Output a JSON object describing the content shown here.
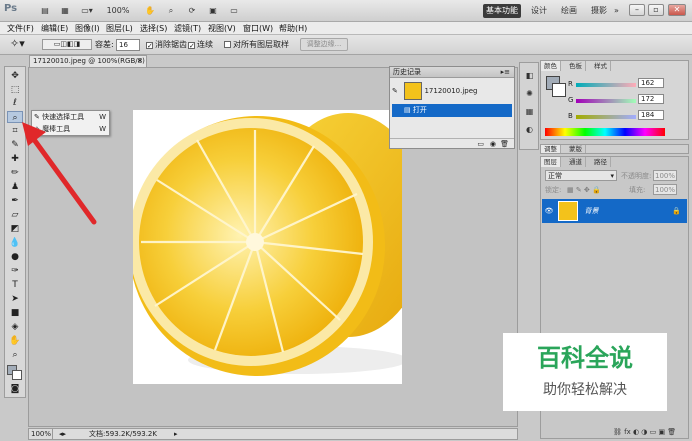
{
  "app": {
    "logo": "Ps",
    "zoom": "100%",
    "workspace_active": "基本功能",
    "workspace_links": [
      "设计",
      "绘画",
      "摄影"
    ],
    "more": "»"
  },
  "menu": [
    "文件(F)",
    "编辑(E)",
    "图像(I)",
    "图层(L)",
    "选择(S)",
    "滤镜(T)",
    "视图(V)",
    "窗口(W)",
    "帮助(H)"
  ],
  "options": {
    "tolerance_label": "容差:",
    "tolerance_value": "16",
    "antialias": "消除锯齿",
    "contiguous": "连续",
    "sample_all": "对所有图层取样",
    "refine": "调整边缘..."
  },
  "document": {
    "tab": "17120010.jpeg @ 100%(RGB/8)",
    "status_zoom": "100%",
    "status_info": "文档:593.2K/593.2K"
  },
  "flyout": [
    {
      "label": "快速选择工具",
      "key": "W"
    },
    {
      "label": "魔棒工具",
      "key": "W"
    }
  ],
  "history": {
    "title": "历史记录",
    "snapshot": "17120010.jpeg",
    "step": "打开"
  },
  "color": {
    "tabs": [
      "颜色",
      "色板",
      "样式"
    ],
    "r_label": "R",
    "r": "162",
    "g_label": "G",
    "g": "172",
    "b_label": "B",
    "b": "184"
  },
  "adjust": {
    "tabs": [
      "调整",
      "蒙版"
    ]
  },
  "layers": {
    "tabs": [
      "图层",
      "通道",
      "路径"
    ],
    "blend": "正常",
    "opacity_label": "不透明度:",
    "opacity": "100%",
    "lock_label": "锁定:",
    "fill_label": "填充:",
    "fill": "100%",
    "layer_name": "背景"
  },
  "watermark": {
    "title": "百科全说",
    "subtitle": "助你轻松解决"
  },
  "colors": {
    "selection_blue": "#1469c7",
    "lemon_yellow": "#f6c518",
    "arrow_red": "#e0282a"
  }
}
